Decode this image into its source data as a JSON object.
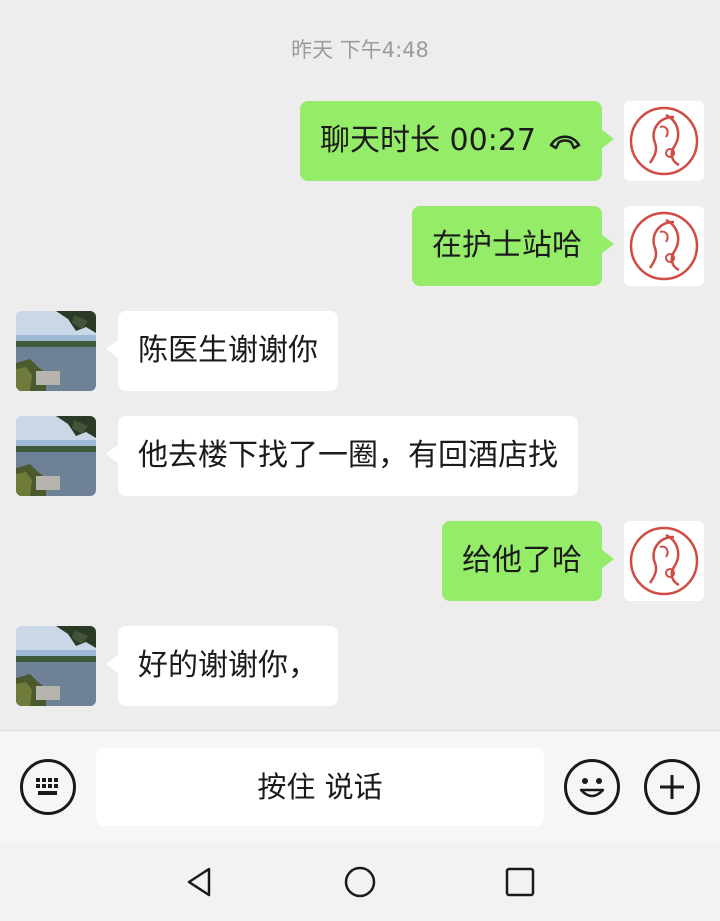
{
  "header": {
    "timestamp": "昨天 下午4:48"
  },
  "messages": [
    {
      "sender": "me",
      "text": "聊天时长 00:27",
      "icon": "phone-hangup-icon"
    },
    {
      "sender": "me",
      "text": "在护士站哈"
    },
    {
      "sender": "peer",
      "text": "陈医生谢谢你"
    },
    {
      "sender": "peer",
      "text": "他去楼下找了一圈，有回酒店找"
    },
    {
      "sender": "me",
      "text": "给他了哈"
    },
    {
      "sender": "peer",
      "text": "好的谢谢你，"
    }
  ],
  "input_bar": {
    "voice_button_label": "按住 说话",
    "icons": [
      "keyboard-icon",
      "emoji-icon",
      "plus-icon"
    ]
  },
  "nav_bar": {
    "icons": [
      "back-icon",
      "home-icon",
      "recents-icon"
    ]
  },
  "colors": {
    "background": "#ededed",
    "my_bubble": "#95ec69",
    "peer_bubble": "#ffffff",
    "timestamp_text": "#9c9c9c",
    "avatar_seal": "#d04b43"
  }
}
